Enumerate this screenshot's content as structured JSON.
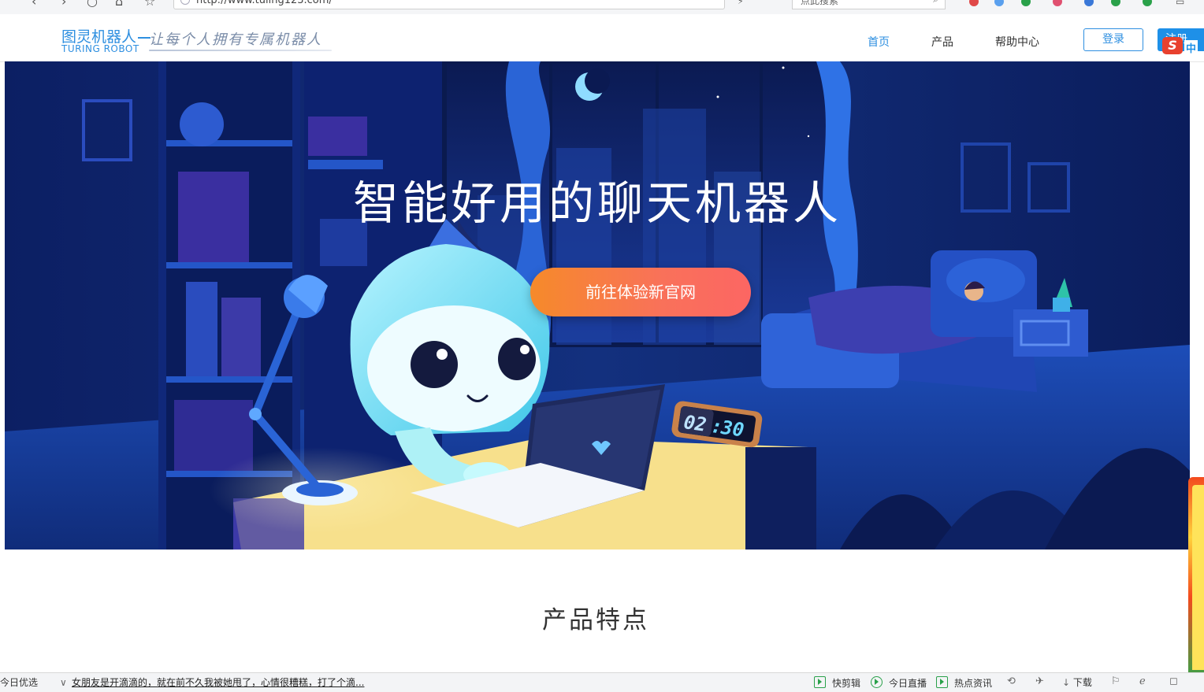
{
  "browser": {
    "url": "http://www.tuling123.com/",
    "search_placeholder": "点此搜索"
  },
  "header": {
    "logo_cn": "图灵机器人",
    "logo_en": "TURING ROBOT",
    "slogan": "让每个人拥有专属机器人",
    "nav": [
      {
        "label": "首页",
        "active": true
      },
      {
        "label": "产品",
        "active": false
      },
      {
        "label": "帮助中心",
        "active": false
      }
    ],
    "login_label": "登录",
    "register_label": "注册",
    "ime_badge": "S",
    "ime_lang": "中"
  },
  "hero": {
    "title": "智能好用的聊天机器人",
    "cta_label": "前往体验新官网",
    "clock_hours": "02",
    "clock_minutes": "30"
  },
  "section": {
    "title": "产品特点"
  },
  "status_bar": {
    "left_label": "今日优选",
    "news": "女朋友是开滴滴的，就在前不久我被她甩了，心情很糟糕，打了个滴...",
    "items": [
      "快剪辑",
      "今日直播",
      "热点资讯"
    ],
    "download_label": "下载"
  },
  "colors": {
    "brand_blue": "#2e8fe0",
    "hero_bg": "#0e1e5c",
    "cta_start": "#f68a2a",
    "cta_end": "#fc6663",
    "status_green": "#2aa14a"
  }
}
